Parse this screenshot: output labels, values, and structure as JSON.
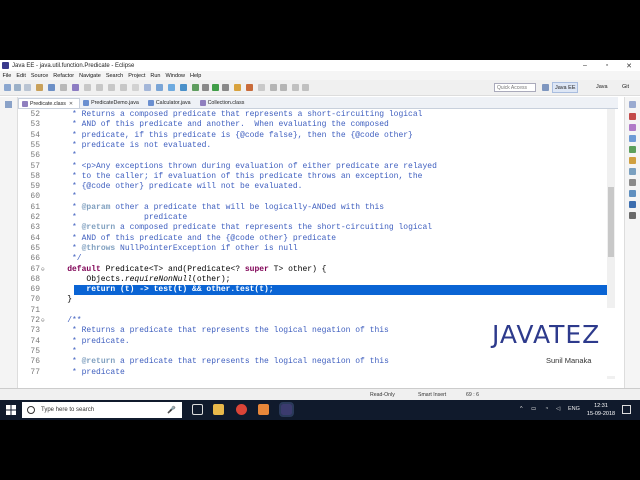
{
  "window": {
    "title": "Java EE - java.util.function.Predicate - Eclipse",
    "minimize": "–",
    "maximize": "▫",
    "close": "✕"
  },
  "menu": [
    "File",
    "Edit",
    "Source",
    "Refactor",
    "Navigate",
    "Search",
    "Project",
    "Run",
    "Window",
    "Help"
  ],
  "toolbar": {
    "quick_access_placeholder": "Quick Access",
    "perspectives": [
      "Java EE",
      "Java",
      "Git"
    ]
  },
  "tabs": [
    {
      "label": "Predicate.class",
      "active": true
    },
    {
      "label": "PredicateDemo.java",
      "active": false
    },
    {
      "label": "Calculator.java",
      "active": false
    },
    {
      "label": "Collection.class",
      "active": false
    }
  ],
  "code_lines": [
    {
      "n": "52",
      "text": "     * Returns a composed predicate that represents a short-circuiting logical"
    },
    {
      "n": "53",
      "text": "     * AND of this predicate and another.  When evaluating the composed"
    },
    {
      "n": "54",
      "text": "     * predicate, if this predicate is {@code false}, then the {@code other}"
    },
    {
      "n": "55",
      "text": "     * predicate is not evaluated."
    },
    {
      "n": "56",
      "text": "     *"
    },
    {
      "n": "57",
      "text": "     * <p>Any exceptions thrown during evaluation of either predicate are relayed"
    },
    {
      "n": "58",
      "text": "     * to the caller; if evaluation of this predicate throws an exception, the"
    },
    {
      "n": "59",
      "text": "     * {@code other} predicate will not be evaluated."
    },
    {
      "n": "60",
      "text": "     *"
    },
    {
      "n": "61",
      "text": "     * @param other a predicate that will be logically-ANDed with this"
    },
    {
      "n": "62",
      "text": "     *              predicate"
    },
    {
      "n": "63",
      "text": "     * @return a composed predicate that represents the short-circuiting logical"
    },
    {
      "n": "64",
      "text": "     * AND of this predicate and the {@code other} predicate"
    },
    {
      "n": "65",
      "text": "     * @throws NullPointerException if other is null"
    },
    {
      "n": "66",
      "text": "     */"
    },
    {
      "n": "67",
      "text": "    default Predicate<T> and(Predicate<? super T> other) {"
    },
    {
      "n": "68",
      "text": "        Objects.requireNonNull(other);"
    },
    {
      "n": "69",
      "text": "        return (t) -> test(t) && other.test(t);"
    },
    {
      "n": "70",
      "text": "    }"
    },
    {
      "n": "71",
      "text": ""
    },
    {
      "n": "72",
      "text": "    /**"
    },
    {
      "n": "73",
      "text": "     * Returns a predicate that represents the logical negation of this"
    },
    {
      "n": "74",
      "text": "     * predicate."
    },
    {
      "n": "75",
      "text": "     *"
    },
    {
      "n": "76",
      "text": "     * @return a predicate that represents the logical negation of this"
    },
    {
      "n": "77",
      "text": "     * predicate"
    }
  ],
  "watermark": {
    "title": "JAVATEZ",
    "subtitle": "Sunil Manaka"
  },
  "status": {
    "mode": "Read-Only",
    "insert": "Smart Insert",
    "position": "69 : 6"
  },
  "taskbar": {
    "search_placeholder": "Type here to search",
    "tray_lang": "ENG",
    "time": "12:31",
    "date": "15-09-2018"
  }
}
